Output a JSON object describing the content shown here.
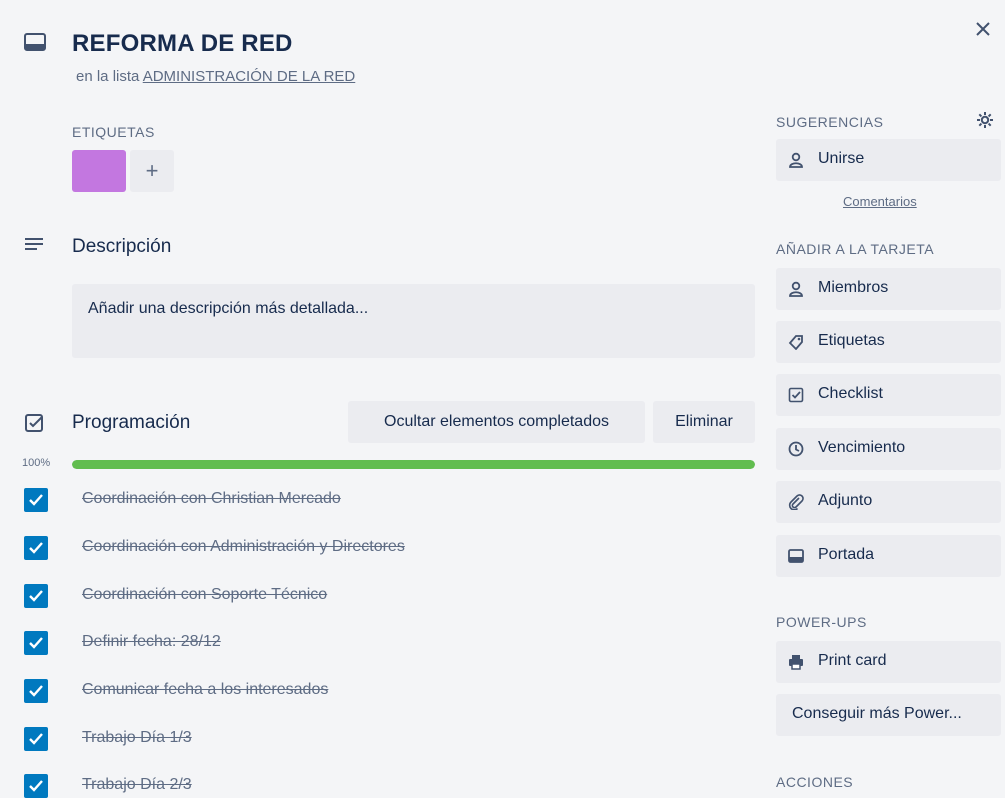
{
  "header": {
    "title": "REFORMA DE RED",
    "in_list_prefix": "en la lista",
    "list_name": "ADMINISTRACIÓN DE LA RED"
  },
  "labels": {
    "heading": "ETIQUETAS",
    "add": "+"
  },
  "description": {
    "heading": "Descripción",
    "placeholder": "Añadir una descripción más detallada..."
  },
  "checklist": {
    "heading": "Programación",
    "hide_completed": "Ocultar elementos completados",
    "delete": "Eliminar",
    "progress_label": "100%",
    "progress": 1.0,
    "items": [
      "Coordinación con Christian Mercado",
      "Coordinación con Administración y Directores",
      "Coordinación con Soporte Técnico",
      "Definir fecha: 28/12",
      "Comunicar fecha a los interesados",
      "Trabajo Día 1/3",
      "Trabajo Día 2/3"
    ]
  },
  "sidebar": {
    "suggestions_heading": "SUGERENCIAS",
    "join": "Unirse",
    "comments_link": "Comentarios",
    "add_heading": "AÑADIR A LA TARJETA",
    "add_items": [
      "Miembros",
      "Etiquetas",
      "Checklist",
      "Vencimiento",
      "Adjunto",
      "Portada"
    ],
    "powerups_heading": "POWER-UPS",
    "print_card": "Print card",
    "more_powerups": "Conseguir más Power...",
    "actions_heading": "ACCIONES"
  },
  "colors": {
    "label": "#c377e0",
    "progress": "#61bd4f",
    "check": "#0079bf"
  }
}
